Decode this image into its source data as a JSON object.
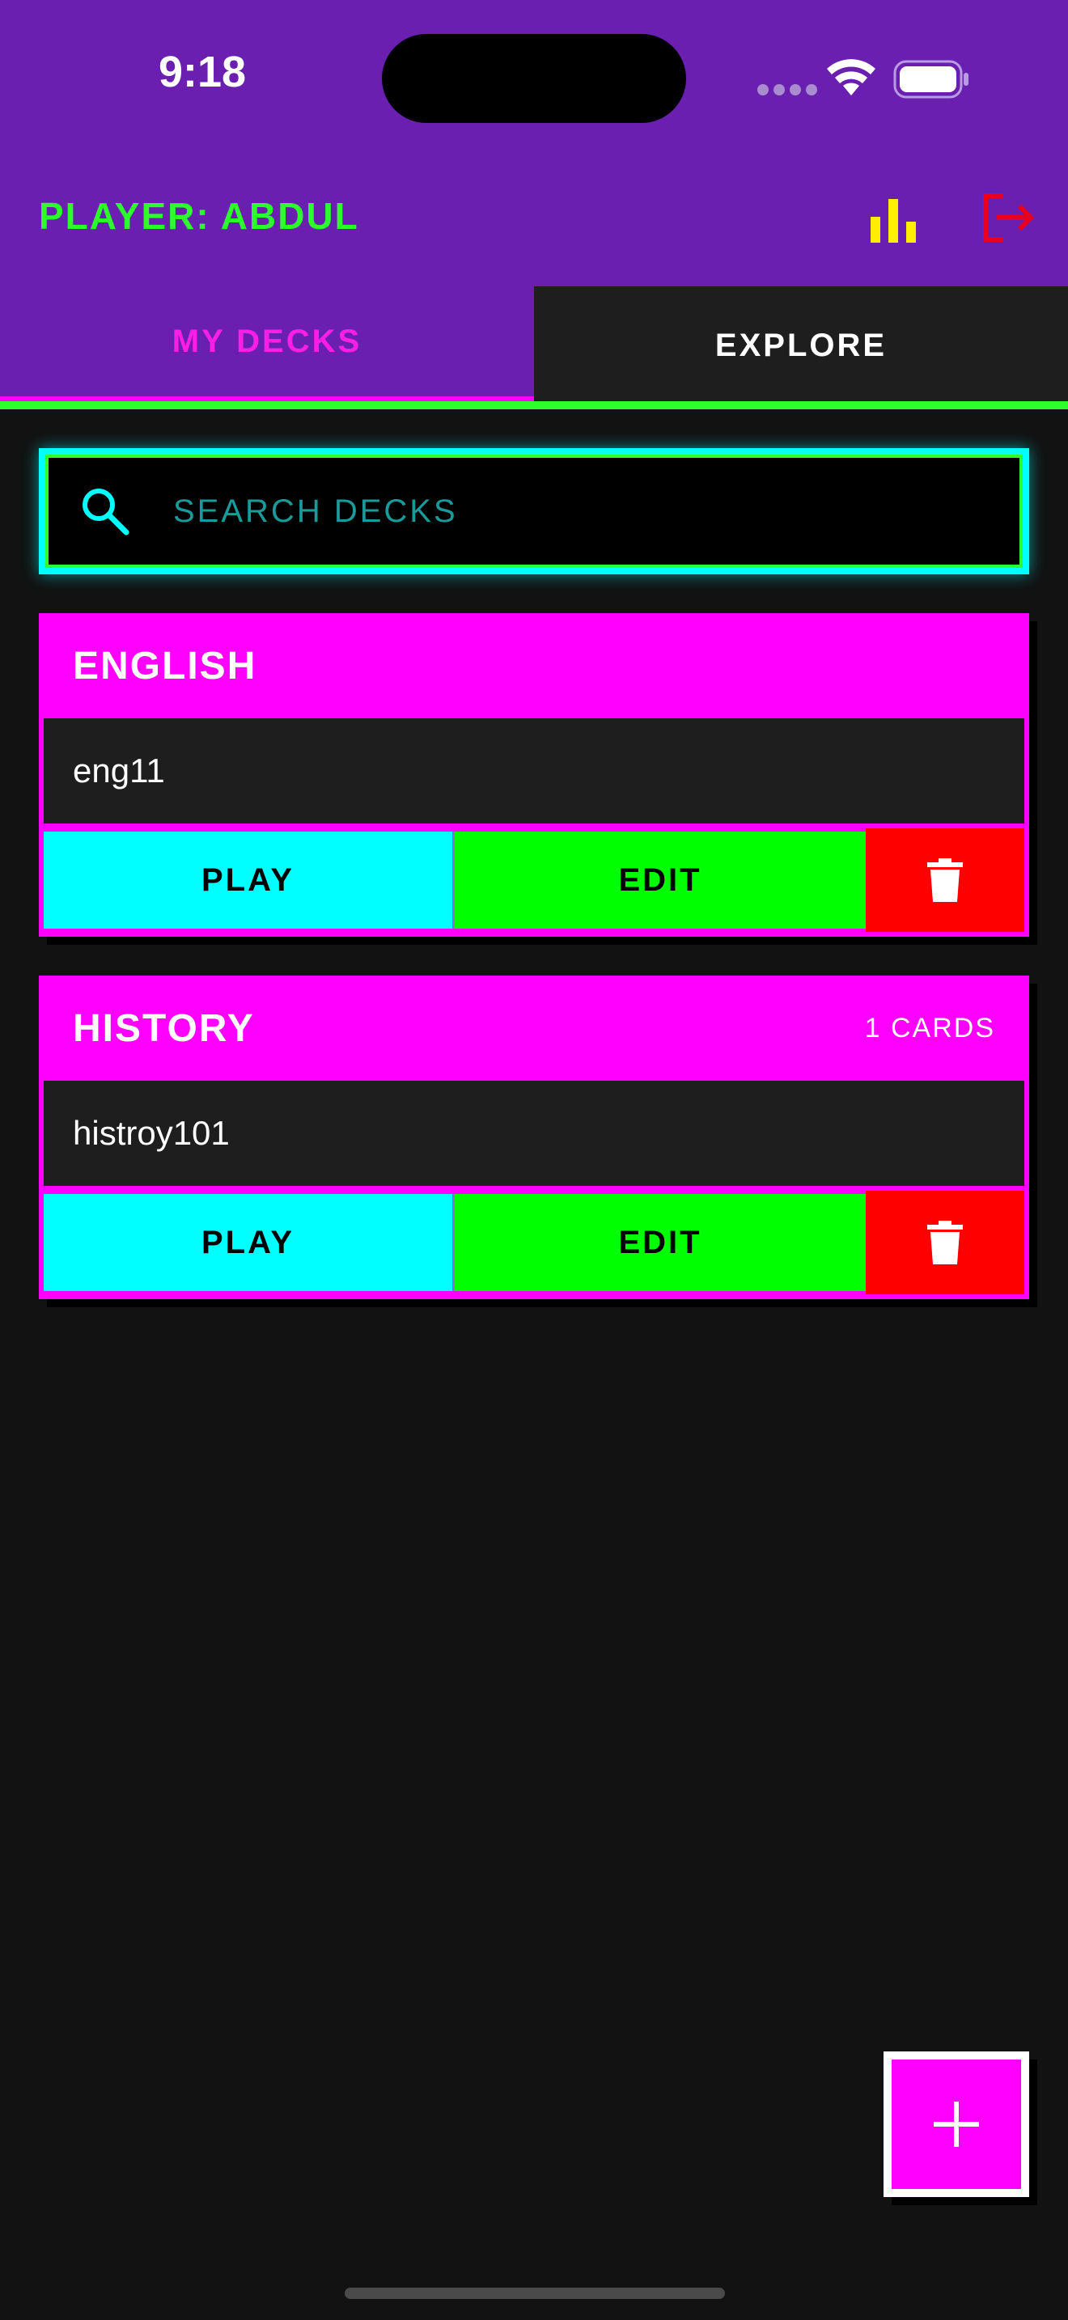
{
  "status_bar": {
    "time": "9:18"
  },
  "header": {
    "player_label": "PLAYER: ABDUL"
  },
  "tabs": [
    {
      "label": "MY DECKS",
      "active": true
    },
    {
      "label": "EXPLORE",
      "active": false
    }
  ],
  "search": {
    "placeholder": "SEARCH DECKS",
    "value": ""
  },
  "decks": [
    {
      "title": "ENGLISH",
      "count": "",
      "description": "eng11",
      "play_label": "PLAY",
      "edit_label": "EDIT"
    },
    {
      "title": "HISTORY",
      "count": "1 CARDS",
      "description": "histroy101",
      "play_label": "PLAY",
      "edit_label": "EDIT"
    }
  ],
  "colors": {
    "header_bg": "#6a1fb0",
    "player_text": "#2cff2c",
    "accent_magenta": "#ff00ff",
    "accent_cyan": "#00ffff",
    "accent_green": "#00ff00",
    "danger_red": "#ff0000",
    "stats_icon": "#ffee00",
    "logout_icon": "#e8001e",
    "page_bg": "#121212"
  },
  "icons": {
    "stats": "bar-chart-icon",
    "logout": "logout-icon",
    "search": "search-icon",
    "delete": "trash-icon",
    "add": "plus-icon"
  }
}
